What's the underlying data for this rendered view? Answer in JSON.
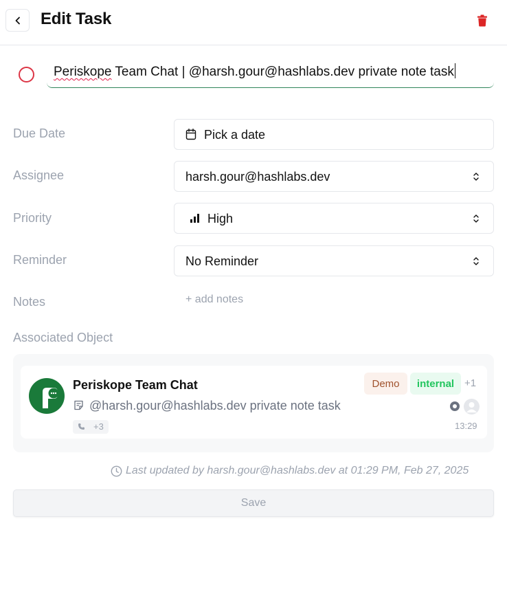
{
  "header": {
    "title": "Edit Task"
  },
  "task": {
    "title_part1": "Periskope",
    "title_part2": " Team Chat | @harsh.gour@hashlabs.dev private note task"
  },
  "fields": {
    "due_date": {
      "label": "Due Date",
      "value": "Pick a date"
    },
    "assignee": {
      "label": "Assignee",
      "value": "harsh.gour@hashlabs.dev"
    },
    "priority": {
      "label": "Priority",
      "value": "High"
    },
    "reminder": {
      "label": "Reminder",
      "value": "No Reminder"
    },
    "notes": {
      "label": "Notes",
      "add_label": "+ add notes"
    }
  },
  "associated": {
    "label": "Associated Object",
    "chat_name": "Periskope Team Chat",
    "tags": [
      "Demo",
      "internal"
    ],
    "more_tags": "+1",
    "last_message": "@harsh.gour@hashlabs.dev private note task",
    "phone_count": "+3",
    "time": "13:29"
  },
  "footer": {
    "last_updated": "Last updated by harsh.gour@hashlabs.dev at 01:29 PM, Feb 27, 2025",
    "save_label": "Save"
  },
  "colors": {
    "delete": "#dc2626",
    "status_circle": "#dc3545",
    "avatar_bg": "#1a7a3a",
    "tag_demo_text": "#a0522d",
    "tag_internal_text": "#22c55e"
  }
}
